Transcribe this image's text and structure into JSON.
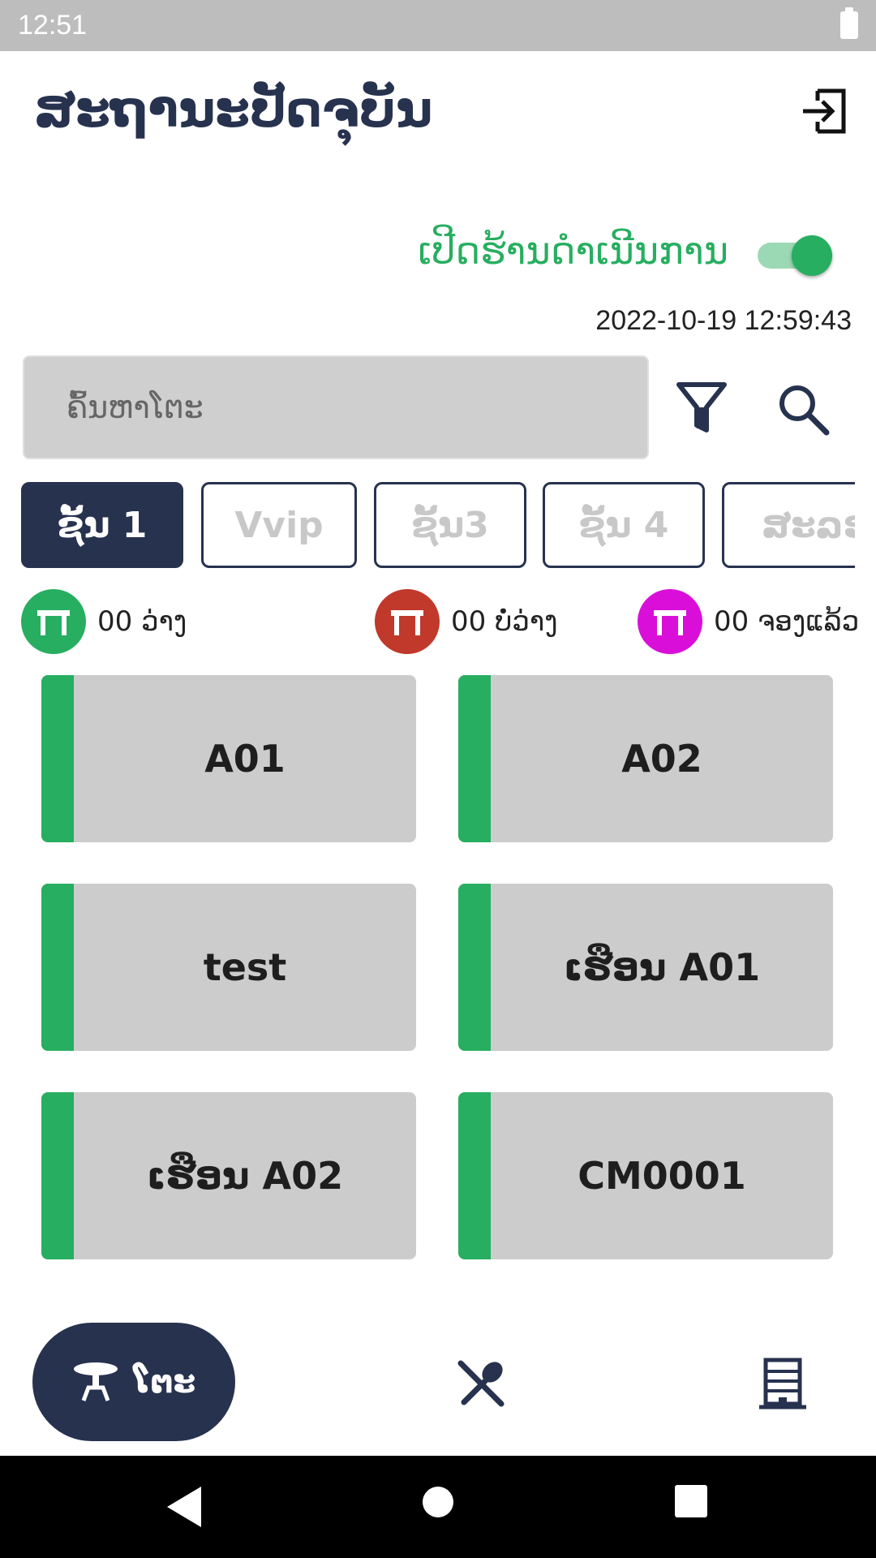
{
  "status_bar": {
    "time": "12:51"
  },
  "header": {
    "title": "ສະຖານະປັດຈຸບັນ"
  },
  "store": {
    "open_label": "ເປີດຮ້ານດຳເນີນການ",
    "open": true,
    "datetime": "2022-10-19 12:59:43"
  },
  "search": {
    "placeholder": "ຄົ້ນຫາໂຕະ"
  },
  "tabs": [
    {
      "label": "ຊັ້ນ 1",
      "active": true
    },
    {
      "label": "Vvip",
      "active": false
    },
    {
      "label": "ຊັ້ນ3",
      "active": false
    },
    {
      "label": "ຊັ້ນ 4",
      "active": false
    },
    {
      "label": "ສະລອ",
      "active": false
    }
  ],
  "legend": [
    {
      "text": "00 ວ່າງ",
      "color": "#27ae60"
    },
    {
      "text": "00 ບໍ່ວ່າງ",
      "color": "#c0392b"
    },
    {
      "text": "00 ຈອງແລ້ວ",
      "color": "#d90fd9"
    }
  ],
  "tables": [
    {
      "name": "A01"
    },
    {
      "name": "A02"
    },
    {
      "name": "test"
    },
    {
      "name": "ເຮືອນ A01"
    },
    {
      "name": "ເຮືອນ A02"
    },
    {
      "name": "CM0001"
    }
  ],
  "bottom_nav": {
    "tables_label": "ໂຕະ",
    "items": [
      "table-icon",
      "utensils-icon",
      "building-icon"
    ]
  },
  "colors": {
    "primary": "#27324f",
    "available": "#27ae60",
    "card": "#cccccc"
  }
}
